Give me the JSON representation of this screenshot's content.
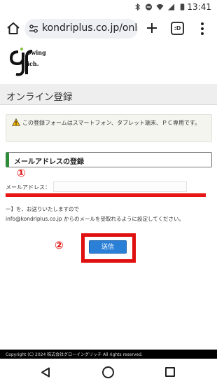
{
  "status_bar": {
    "time": "13:41",
    "icons": [
      "bluetooth-icon",
      "do-not-disturb-icon",
      "wifi-icon",
      "signal-icon",
      "battery-icon"
    ]
  },
  "browser": {
    "url": "kondriplus.co.jp/onlin",
    "tabs_label": ":D",
    "icons": [
      "home-icon",
      "page-info-icon",
      "new-tab-plus-icon",
      "tab-switcher-icon",
      "more-menu-icon"
    ]
  },
  "logo": {
    "line1": "owing",
    "line2": "ich."
  },
  "page": {
    "title": "オンライン登録",
    "notice": "この登録フォームはスマートフォン、タブレット端末、ＰＣ専用です。",
    "section_title": "メールアドレスの登録",
    "email_label": "メールアドレス：",
    "email_value": "",
    "desc_line1": "ー】を、お送りいたしますので",
    "desc_line2": "info@kondriplus.co.jp からのメールを受取れるように設定してください。",
    "send_button": "送信"
  },
  "annotations": {
    "marker1": "①",
    "marker2": "②",
    "color": "#e01010"
  },
  "footer": {
    "copyright": "Copyright (C) 2024 株式会社グローイングリッチ All rights reserved."
  },
  "colors": {
    "accent_green": "#2e8b3a",
    "button_blue": "#2a7fd6"
  }
}
